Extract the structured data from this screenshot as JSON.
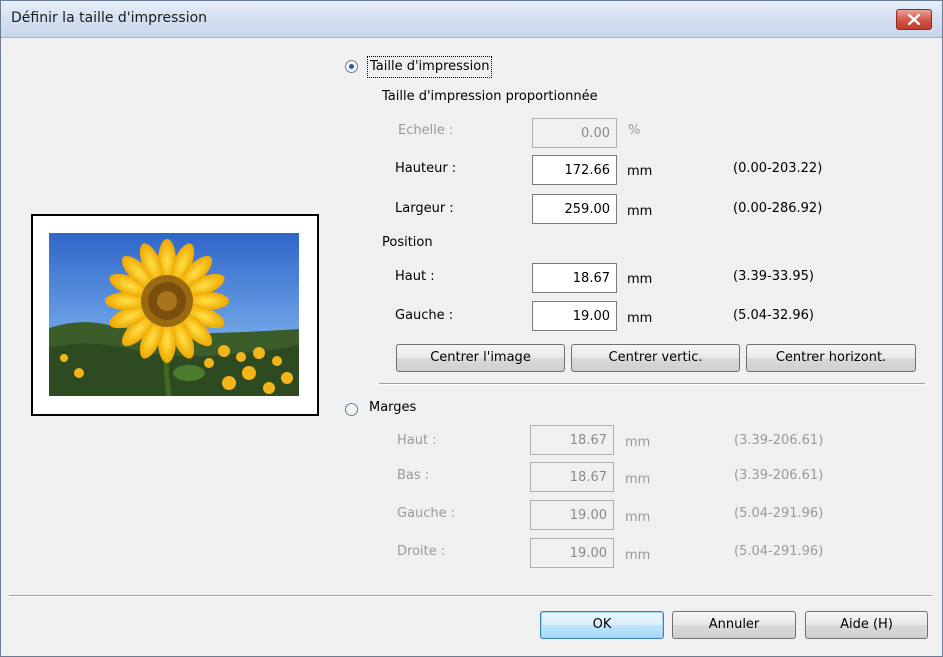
{
  "window": {
    "title": "Définir la taille d'impression"
  },
  "icons": {
    "close": "close-icon",
    "preview": "sunflower-photo"
  },
  "print_size": {
    "radio_label": "Taille d'impression",
    "selected": true,
    "proportional_heading": "Taille d'impression proportionnée",
    "scale": {
      "label": "Echelle :",
      "value": "0.00",
      "unit": "%"
    },
    "height": {
      "label": "Hauteur :",
      "value": "172.66",
      "unit": "mm",
      "range": "(0.00-203.22)"
    },
    "width": {
      "label": "Largeur :",
      "value": "259.00",
      "unit": "mm",
      "range": "(0.00-286.92)"
    },
    "position_heading": "Position",
    "top": {
      "label": "Haut :",
      "value": "18.67",
      "unit": "mm",
      "range": "(3.39-33.95)"
    },
    "left": {
      "label": "Gauche :",
      "value": "19.00",
      "unit": "mm",
      "range": "(5.04-32.96)"
    },
    "buttons": {
      "center_image": "Centrer l'image",
      "center_vertical": "Centrer vertic.",
      "center_horizontal": "Centrer horizont."
    }
  },
  "margins": {
    "radio_label": "Marges",
    "selected": false,
    "top": {
      "label": "Haut :",
      "value": "18.67",
      "unit": "mm",
      "range": "(3.39-206.61)"
    },
    "bottom": {
      "label": "Bas :",
      "value": "18.67",
      "unit": "mm",
      "range": "(3.39-206.61)"
    },
    "left": {
      "label": "Gauche :",
      "value": "19.00",
      "unit": "mm",
      "range": "(5.04-291.96)"
    },
    "right": {
      "label": "Droite :",
      "value": "19.00",
      "unit": "mm",
      "range": "(5.04-291.96)"
    }
  },
  "footer": {
    "ok": "OK",
    "cancel": "Annuler",
    "help": "Aide (H)"
  },
  "colors": {
    "accent": "#2a5aa6",
    "disabled_text": "#9a9a9a",
    "close_button": "#c13b2c"
  }
}
